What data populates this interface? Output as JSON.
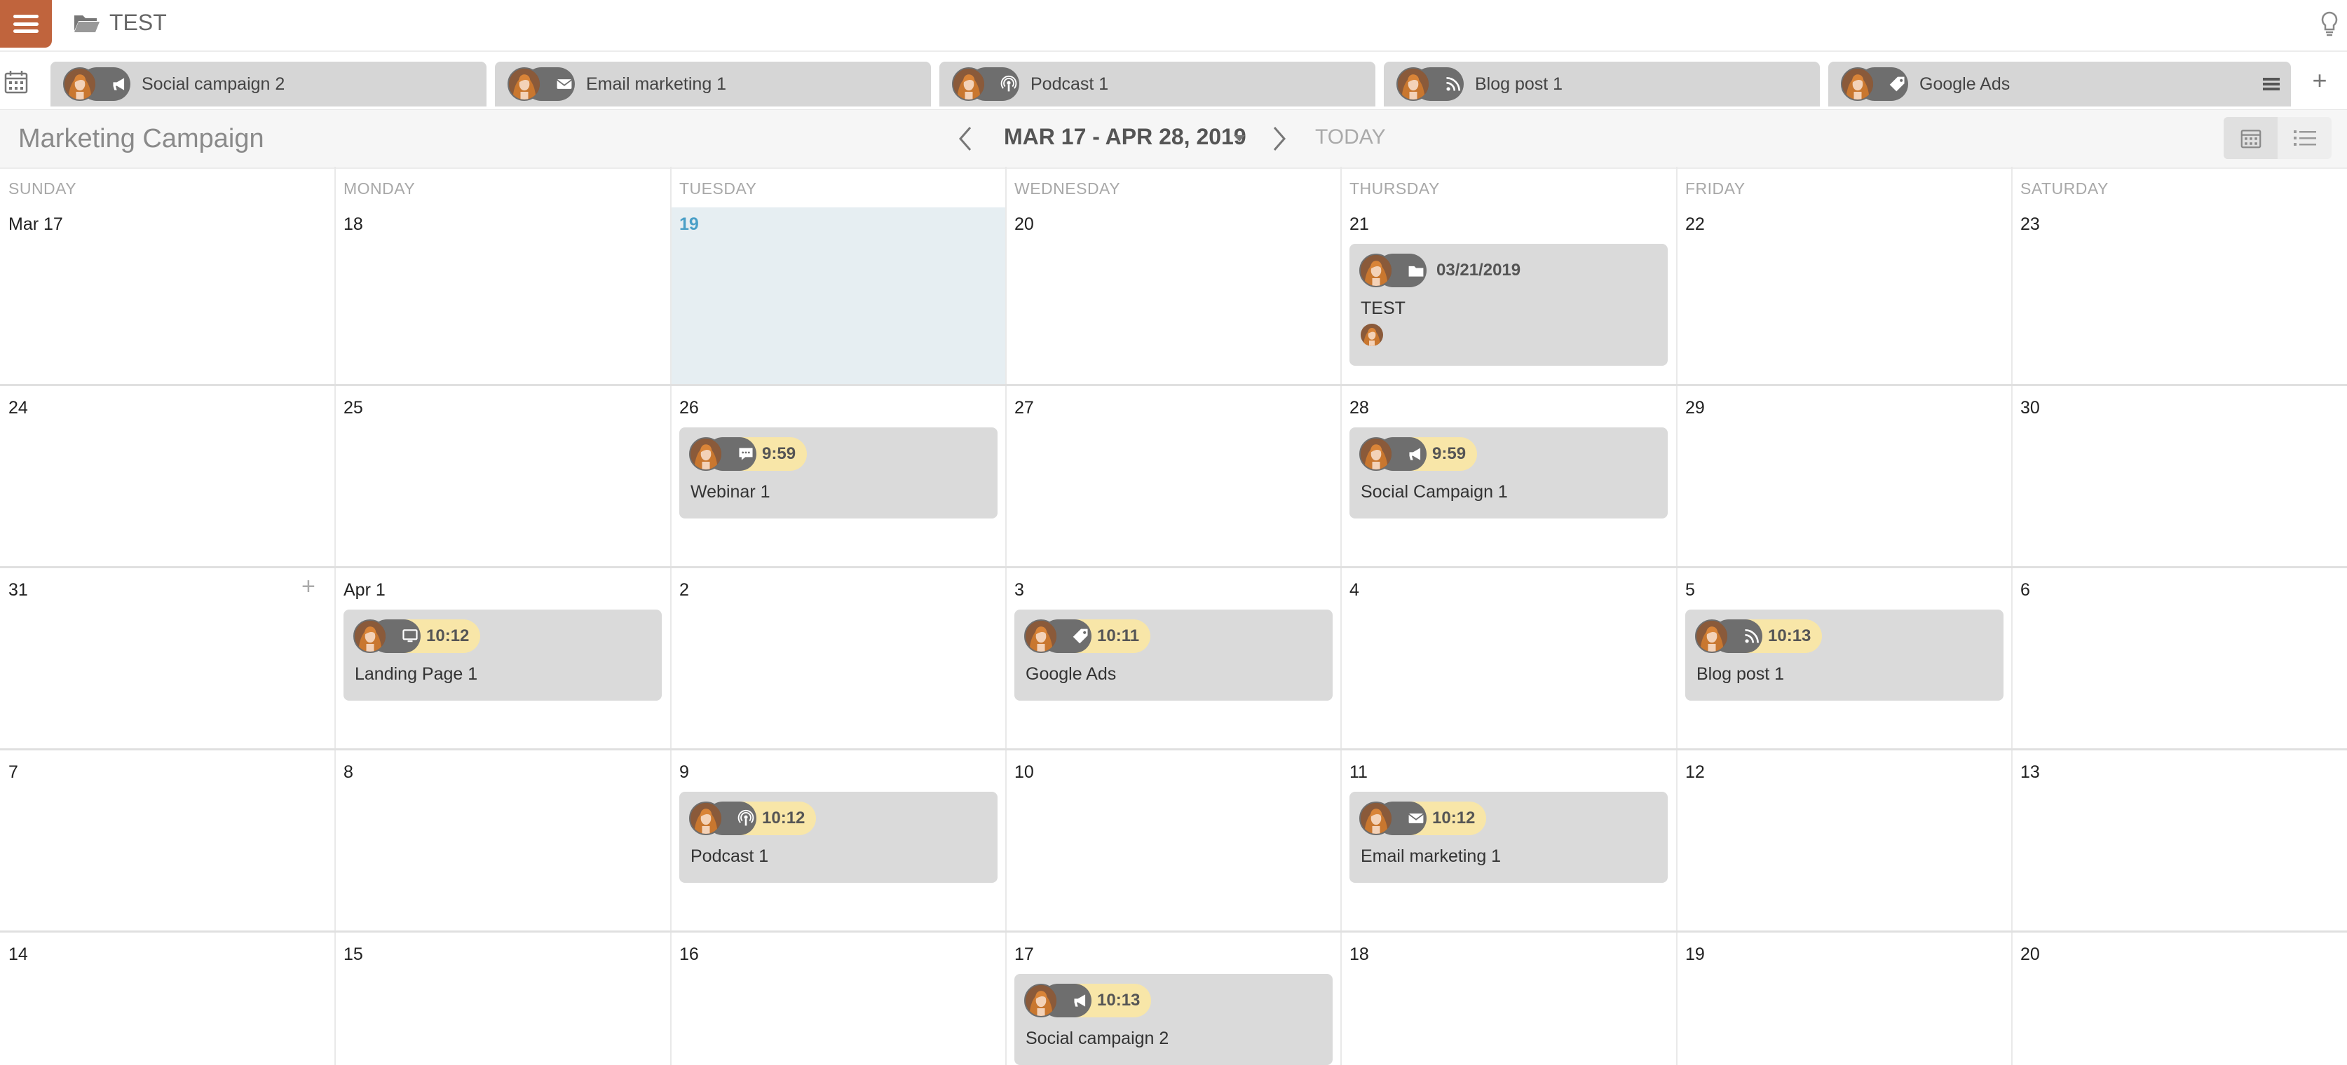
{
  "app": {
    "project_name": "TEST"
  },
  "tabs": [
    {
      "label": "Social campaign 2",
      "icon": "megaphone-icon"
    },
    {
      "label": "Email marketing 1",
      "icon": "envelope-icon"
    },
    {
      "label": "Podcast 1",
      "icon": "podcast-icon"
    },
    {
      "label": "Blog post 1",
      "icon": "rss-icon"
    },
    {
      "label": "Google Ads",
      "icon": "tag-icon"
    }
  ],
  "header": {
    "title": "Marketing Campaign",
    "range": "MAR 17 - APR 28, 2019",
    "today_label": "TODAY"
  },
  "calendar": {
    "day_names": [
      "SUNDAY",
      "MONDAY",
      "TUESDAY",
      "WEDNESDAY",
      "THURSDAY",
      "FRIDAY",
      "SATURDAY"
    ],
    "weeks": [
      [
        "Mar 17",
        "18",
        "19",
        "20",
        "21",
        "22",
        "23"
      ],
      [
        "24",
        "25",
        "26",
        "27",
        "28",
        "29",
        "30"
      ],
      [
        "31",
        "Apr 1",
        "2",
        "3",
        "4",
        "5",
        "6"
      ],
      [
        "7",
        "8",
        "9",
        "10",
        "11",
        "12",
        "13"
      ],
      [
        "14",
        "15",
        "16",
        "17",
        "18",
        "19",
        "20"
      ]
    ],
    "today": "19"
  },
  "events": [
    {
      "week": 0,
      "day": 4,
      "date_label": "03/21/2019",
      "title": "TEST",
      "icon": "folder-icon",
      "kind": "date"
    },
    {
      "week": 1,
      "day": 2,
      "time": "9:59",
      "title": "Webinar 1",
      "icon": "chat-icon"
    },
    {
      "week": 1,
      "day": 4,
      "time": "9:59",
      "title": "Social Campaign 1",
      "icon": "megaphone-icon"
    },
    {
      "week": 2,
      "day": 1,
      "time": "10:12",
      "title": "Landing Page 1",
      "icon": "monitor-icon"
    },
    {
      "week": 2,
      "day": 3,
      "time": "10:11",
      "title": "Google Ads",
      "icon": "tag-icon"
    },
    {
      "week": 2,
      "day": 5,
      "time": "10:13",
      "title": "Blog post 1",
      "icon": "rss-icon"
    },
    {
      "week": 3,
      "day": 2,
      "time": "10:12",
      "title": "Podcast 1",
      "icon": "podcast-icon"
    },
    {
      "week": 3,
      "day": 4,
      "time": "10:12",
      "title": "Email marketing 1",
      "icon": "envelope-icon"
    },
    {
      "week": 4,
      "day": 3,
      "time": "10:13",
      "title": "Social campaign 2",
      "icon": "megaphone-icon"
    }
  ],
  "colors": {
    "accent": "#c0643d",
    "event_bg": "#dadada",
    "time_pill": "#f8e6a8",
    "today_bg": "#e6eef2"
  }
}
